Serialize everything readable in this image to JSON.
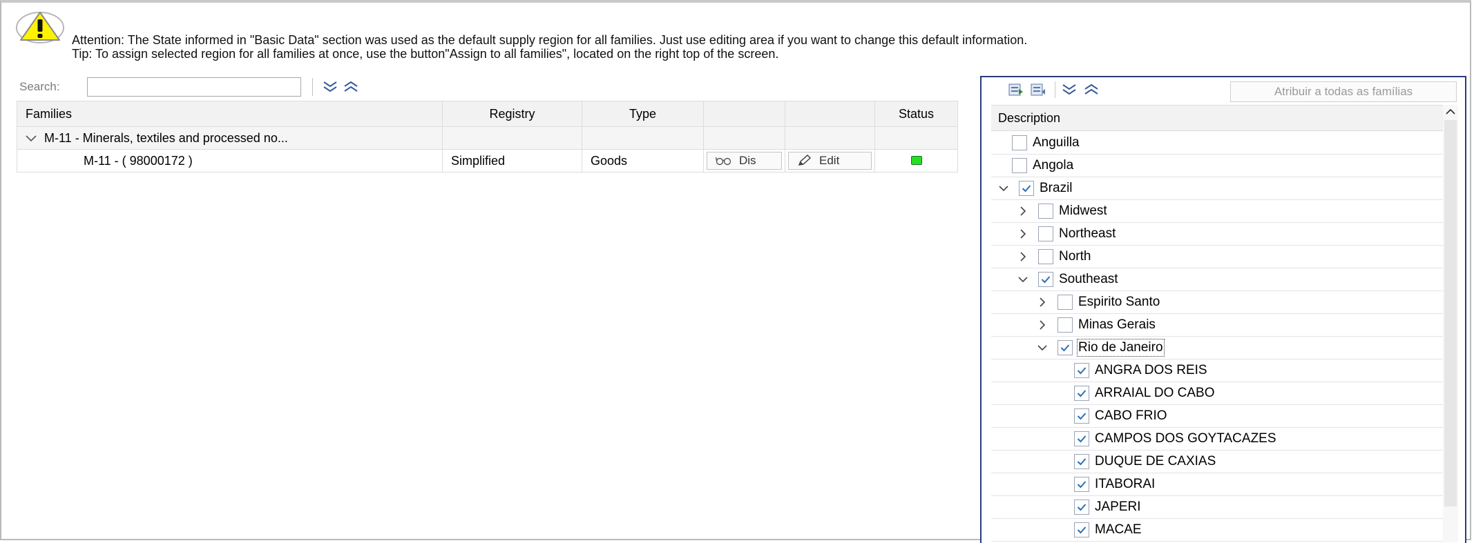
{
  "attention": {
    "line1": "Attention: The State informed in \"Basic Data\" section was used as the default supply region for all families. Just use editing area if you want to change this default information.",
    "line2": "Tip: To assign selected region for all families at once, use the button\"Assign to all families\", located on the right top of the screen."
  },
  "toolbar": {
    "search_label": "Search:",
    "search_value": ""
  },
  "table": {
    "columns": [
      "Families",
      "Registry",
      "Type",
      "",
      "",
      "Status"
    ],
    "group": {
      "label": "M-11 - Minerals, textiles and processed no..."
    },
    "rows": [
      {
        "family": "M-11 -  ( 98000172 )",
        "registry": "Simplified",
        "type": "Goods",
        "display_label": "Dis",
        "edit_label": "Edit",
        "status": "green"
      }
    ]
  },
  "panel": {
    "assign_button": "Atribuir a todas as famílias",
    "header": "Description",
    "tree": [
      {
        "label": "Anguilla",
        "level": 0,
        "expander": "",
        "checked": false
      },
      {
        "label": "Angola",
        "level": 0,
        "expander": "",
        "checked": false
      },
      {
        "label": "Brazil",
        "level": 0,
        "expander": "expanded",
        "checked": true
      },
      {
        "label": "Midwest",
        "level": 1,
        "expander": "collapsed",
        "checked": false
      },
      {
        "label": "Northeast",
        "level": 1,
        "expander": "collapsed",
        "checked": false
      },
      {
        "label": "North",
        "level": 1,
        "expander": "collapsed",
        "checked": false
      },
      {
        "label": "Southeast",
        "level": 1,
        "expander": "expanded",
        "checked": true
      },
      {
        "label": "Espirito Santo",
        "level": 2,
        "expander": "collapsed",
        "checked": false
      },
      {
        "label": "Minas Gerais",
        "level": 2,
        "expander": "collapsed",
        "checked": false
      },
      {
        "label": "Rio de Janeiro",
        "level": 2,
        "expander": "expanded",
        "checked": true
      },
      {
        "label": "ANGRA DOS REIS",
        "level": 3,
        "expander": "",
        "checked": true
      },
      {
        "label": "ARRAIAL DO CABO",
        "level": 3,
        "expander": "",
        "checked": true
      },
      {
        "label": "CABO FRIO",
        "level": 3,
        "expander": "",
        "checked": true
      },
      {
        "label": "CAMPOS DOS GOYTACAZES",
        "level": 3,
        "expander": "",
        "checked": true
      },
      {
        "label": "DUQUE DE CAXIAS",
        "level": 3,
        "expander": "",
        "checked": true
      },
      {
        "label": "ITABORAI",
        "level": 3,
        "expander": "",
        "checked": true
      },
      {
        "label": "JAPERI",
        "level": 3,
        "expander": "",
        "checked": true
      },
      {
        "label": "MACAE",
        "level": 3,
        "expander": "",
        "checked": true
      }
    ]
  },
  "colors": {
    "panel_border": "#2b3a7a",
    "status_green": "#22e022",
    "check_blue": "#2a6fb5"
  }
}
